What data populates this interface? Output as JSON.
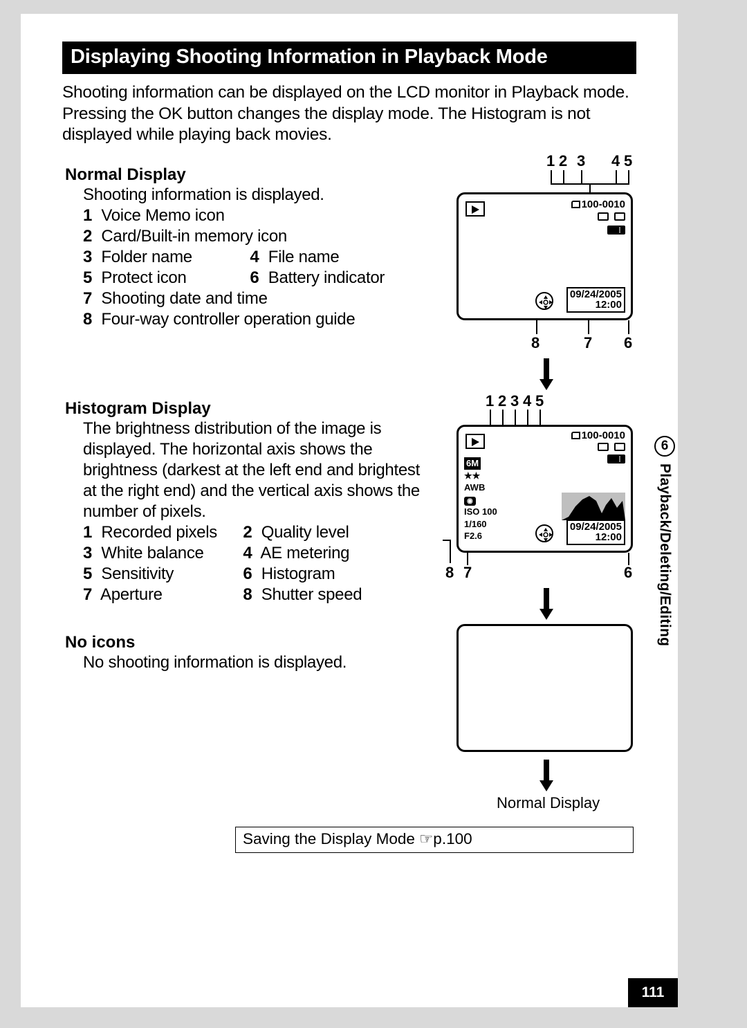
{
  "title": "Displaying Shooting Information in Playback Mode",
  "intro": "Shooting information can be displayed on the LCD monitor in Playback mode. Pressing the OK button changes the display mode. The Histogram is not displayed while playing back movies.",
  "sections": {
    "normal": {
      "head": "Normal Display",
      "desc": "Shooting information is displayed.",
      "items": {
        "1": "Voice Memo icon",
        "2": "Card/Built-in memory icon",
        "3": "Folder name",
        "4": "File name",
        "5": "Protect icon",
        "6": "Battery indicator",
        "7": "Shooting date and time",
        "8": "Four-way controller operation guide"
      }
    },
    "histogram": {
      "head": "Histogram Display",
      "desc": "The brightness distribution of the image is displayed. The horizontal axis shows the brightness (darkest at the left end and brightest at the right end) and the vertical axis shows the number of pixels.",
      "items": {
        "1": "Recorded pixels",
        "2": "Quality level",
        "3": "White balance",
        "4": "AE metering",
        "5": "Sensitivity",
        "6": "Histogram",
        "7": "Aperture",
        "8": "Shutter speed"
      }
    },
    "noicons": {
      "head": "No icons",
      "desc": "No shooting information is displayed."
    }
  },
  "lcd_normal": {
    "folder_file": "100-0010",
    "date": "09/24/2005",
    "time": "12:00",
    "callouts_top": [
      "1",
      "2",
      "3",
      "4",
      "5"
    ],
    "callouts_bottom": [
      "8",
      "7",
      "6"
    ]
  },
  "lcd_histo": {
    "folder_file": "100-0010",
    "date": "09/24/2005",
    "time": "12:00",
    "left_info": [
      "6M",
      "★★",
      "AWB",
      "",
      "ISO 100",
      "1/160",
      "F2.6"
    ],
    "callouts_top": [
      "1",
      "2",
      "3",
      "4",
      "5"
    ],
    "callouts_bottom": [
      "8",
      "7",
      "6"
    ]
  },
  "normal_display_label": "Normal Display",
  "ref_box": "Saving the Display Mode ☞p.100",
  "side_tab": {
    "num": "6",
    "label": "Playback/Deleting/Editing"
  },
  "page_num": "111"
}
